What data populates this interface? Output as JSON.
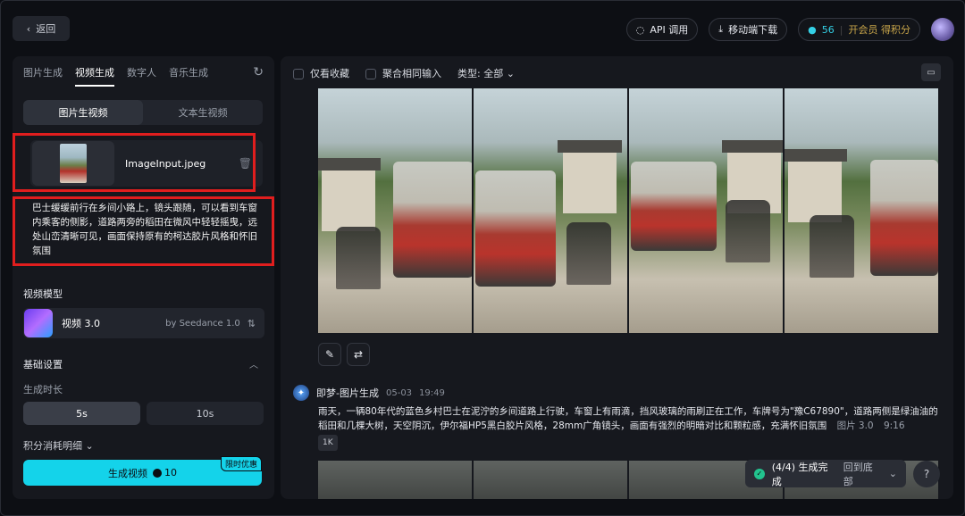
{
  "topbar": {
    "back_label": "返回",
    "api_label": "API 调用",
    "download_label": "移动端下载",
    "points": "56",
    "vip_label": "开会员 得积分"
  },
  "left": {
    "tabs": [
      "图片生成",
      "视频生成",
      "数字人",
      "音乐生成"
    ],
    "active_tab": "视频生成",
    "modes": [
      "图片生视频",
      "文本生视频"
    ],
    "upload_filename": "ImageInput.jpeg",
    "prompt": "巴士缓缓前行在乡间小路上，镜头跟随，可以看到车窗内乘客的侧影，道路两旁的稻田在微风中轻轻摇曳，远处山峦清晰可见，画面保持原有的柯达胶片风格和怀旧氛围",
    "model_section_label": "视频模型",
    "model_name": "视频 3.0",
    "model_by": "by Seedance 1.0",
    "basic_settings_label": "基础设置",
    "duration_label": "生成时长",
    "durations": [
      "5s",
      "10s"
    ],
    "selected_duration": "5s",
    "cost_detail_label": "积分消耗明细",
    "generate_label": "生成视频",
    "generate_cost": "10",
    "promo_badge": "限时优惠"
  },
  "right": {
    "filter_favorites": "仅看收藏",
    "filter_merge": "聚合相同输入",
    "type_filter": "类型: 全部",
    "generation": {
      "source": "即梦-图片生成",
      "date": "05-03",
      "time": "19:49",
      "description": "雨天，一辆80年代的蓝色乡村巴士在泥泞的乡间道路上行驶，车窗上有雨滴，挡风玻璃的雨刷正在工作，车牌号为\"豫C67890\"，道路两侧是绿油油的稻田和几棵大树，天空阴沉，伊尔福HP5黑白胶片风格，28mm广角镜头，画面有强烈的明暗对比和颗粒感，充满怀旧氛围",
      "model": "图片 3.0",
      "ratio": "9:16",
      "resolution": "1K"
    },
    "toast_status": "(4/4) 生成完成",
    "toast_link": "回到底部"
  },
  "colors": {
    "accent": "#14d3ea",
    "highlight_box": "#e01e1e"
  }
}
